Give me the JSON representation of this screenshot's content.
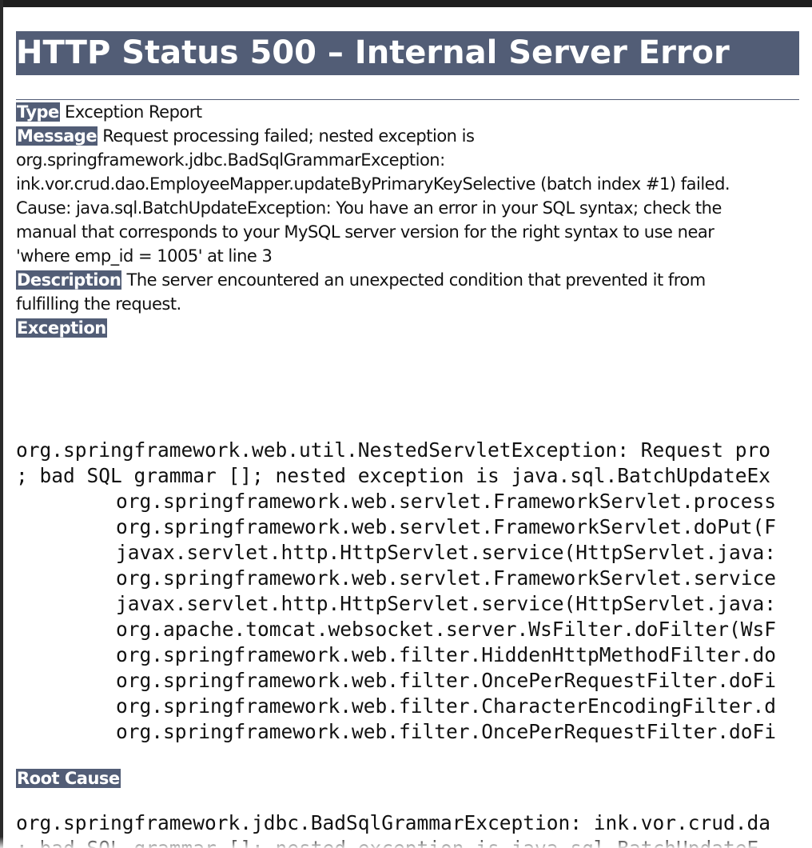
{
  "page": {
    "title": "HTTP Status 500 – Internal Server Error"
  },
  "type": {
    "label": "Type",
    "text": " Exception Report"
  },
  "message": {
    "label": "Message",
    "line1": " Request processing failed; nested exception is",
    "line2": "org.springframework.jdbc.BadSqlGrammarException:",
    "line3": "ink.vor.crud.dao.EmployeeMapper.updateByPrimaryKeySelective (batch index #1) failed.",
    "line4": "Cause: java.sql.BatchUpdateException: You have an error in your SQL syntax; check the",
    "line5": "manual that corresponds to your MySQL server version for the right syntax to use near",
    "line6": "'where emp_id = 1005' at line 3"
  },
  "description": {
    "label": "Description",
    "line1": " The server encountered an unexpected condition that prevented it from",
    "line2": "fulfilling the request."
  },
  "exception": {
    "label": "Exception",
    "lines": [
      "org.springframework.web.util.NestedServletException: Request pro",
      "; bad SQL grammar []; nested exception is java.sql.BatchUpdateEx",
      "org.springframework.web.servlet.FrameworkServlet.process",
      "org.springframework.web.servlet.FrameworkServlet.doPut(F",
      "javax.servlet.http.HttpServlet.service(HttpServlet.java:",
      "org.springframework.web.servlet.FrameworkServlet.service",
      "javax.servlet.http.HttpServlet.service(HttpServlet.java:",
      "org.apache.tomcat.websocket.server.WsFilter.doFilter(WsF",
      "org.springframework.web.filter.HiddenHttpMethodFilter.do",
      "org.springframework.web.filter.OncePerRequestFilter.doFi",
      "org.springframework.web.filter.CharacterEncodingFilter.d",
      "org.springframework.web.filter.OncePerRequestFilter.doFi"
    ]
  },
  "root_cause": {
    "label": "Root Cause",
    "lines": [
      "org.springframework.jdbc.BadSqlGrammarException: ink.vor.crud.da",
      "; bad SQL grammar []; nested exception is java.sql.BatchUpdateE"
    ]
  },
  "colors": {
    "accent": "#525d76",
    "text": "#111111",
    "background": "#ffffff"
  }
}
